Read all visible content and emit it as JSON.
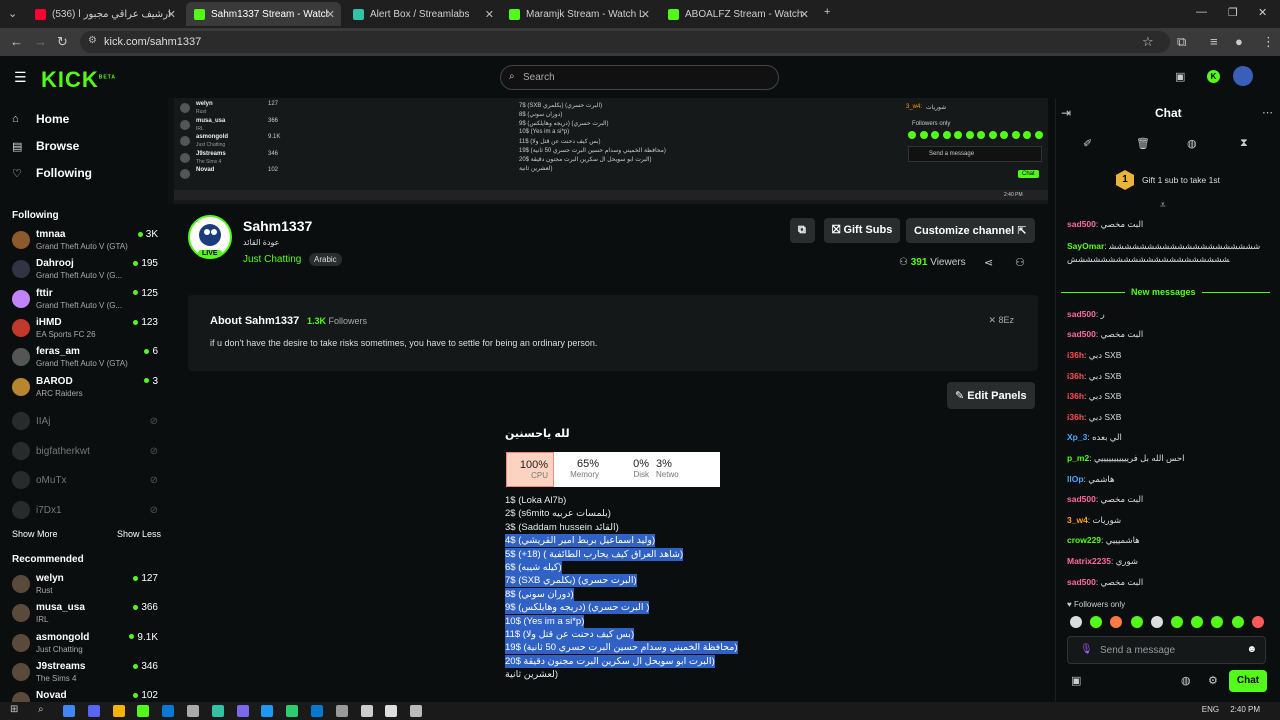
{
  "browser": {
    "tabs": [
      {
        "title": "(536) أرشيف عراقي مجبور أ...",
        "color": "#ff0033",
        "active": false
      },
      {
        "title": "Sahm1337 Stream - Watch Live",
        "color": "#53fc18",
        "active": true
      },
      {
        "title": "Alert Box / Streamlabs",
        "color": "#31c3a2",
        "active": false
      },
      {
        "title": "Maramjk Stream - Watch Live o...",
        "color": "#53fc18",
        "active": false
      },
      {
        "title": "ABOALFZ Stream - Watch Live ...",
        "color": "#53fc18",
        "active": false
      }
    ],
    "new_tab": "+",
    "url": "kick.com/sahm1337"
  },
  "header": {
    "logo": "KICK",
    "logo_sup": "BETA",
    "search_placeholder": "Search"
  },
  "sidebar": {
    "nav": [
      {
        "label": "Home",
        "icon": "home-icon",
        "glyph": "⌂"
      },
      {
        "label": "Browse",
        "icon": "browse-icon",
        "glyph": "▤"
      },
      {
        "label": "Following",
        "icon": "heart-icon",
        "glyph": "♡"
      }
    ],
    "following_title": "Following",
    "following": [
      {
        "name": "tmnaa",
        "game": "Grand Theft Auto V (GTA)",
        "viewers": "3K",
        "live": true
      },
      {
        "name": "Dahrooj",
        "game": "Grand Theft Auto V (G...",
        "viewers": "195",
        "live": true
      },
      {
        "name": "fttir",
        "game": "Grand Theft Auto V (G...",
        "viewers": "125",
        "live": true
      },
      {
        "name": "iHMD",
        "game": "EA Sports FC 26",
        "viewers": "123",
        "live": true
      },
      {
        "name": "feras_am",
        "game": "Grand Theft Auto V (GTA)",
        "viewers": "6",
        "live": true
      },
      {
        "name": "BAROD",
        "game": "ARC Raiders",
        "viewers": "3",
        "live": true
      },
      {
        "name": "IIAj",
        "game": "",
        "viewers": "",
        "live": false
      },
      {
        "name": "bigfatherkwt",
        "game": "",
        "viewers": "",
        "live": false
      },
      {
        "name": "oMuTx",
        "game": "",
        "viewers": "",
        "live": false
      },
      {
        "name": "i7Dx1",
        "game": "",
        "viewers": "",
        "live": false
      }
    ],
    "show_more": "Show More",
    "show_less": "Show Less",
    "recommended_title": "Recommended",
    "recommended": [
      {
        "name": "welyn",
        "game": "Rust",
        "viewers": "127"
      },
      {
        "name": "musa_usa",
        "game": "IRL",
        "viewers": "366"
      },
      {
        "name": "asmongold",
        "game": "Just Chatting",
        "viewers": "9.1K"
      },
      {
        "name": "J9streams",
        "game": "The Sims 4",
        "viewers": "346"
      },
      {
        "name": "Novad",
        "game": "",
        "viewers": "102"
      }
    ]
  },
  "stream_preview": {
    "mini_channels": [
      {
        "name": "welyn",
        "game": "Rust",
        "viewers": "127"
      },
      {
        "name": "musa_usa",
        "game": "IRL",
        "viewers": "366"
      },
      {
        "name": "asmongold",
        "game": "Just Chatting",
        "viewers": "9.1K"
      },
      {
        "name": "J9streams",
        "game": "The Sims 4",
        "viewers": "346"
      },
      {
        "name": "Novad",
        "game": "",
        "viewers": "102"
      }
    ],
    "mini_lines": [
      "7$ (SXB بكلمري) (البرت حسري)",
      "8$ (دوران سوني)",
      "9$ (دريجه وهايلكس) (البرت حسري)",
      "10$ (Yes im a si*p)",
      "11$ (بس كيف دحنت عن قتل ولا)",
      "19$ (محافظة الخميني وسدام حسين البرت حسري 50 ثانية)",
      "20$ البرت ابو سويحل ال سكرين البرت مجنون دقيقة)",
      "لعشرين ثانية)"
    ],
    "mini_chat_user": "3_w4:",
    "mini_chat_text": "شوريات",
    "mini_followers": "Followers only",
    "mini_send": "Send a message",
    "mini_chat_btn": "Chat",
    "mini_time": "2:40 PM"
  },
  "channel": {
    "name": "Sahm1337",
    "subtitle": "عودة القائد",
    "live_badge": "LIVE",
    "category": "Just Chatting",
    "language": "Arabic",
    "gift_subs": "Gift Subs",
    "customize": "Customize channel",
    "viewers_count": "391",
    "viewers_label": "Viewers"
  },
  "about": {
    "title": "About Sahm1337",
    "followers_count": "1.3K",
    "followers_label": "Followers",
    "description": "if u don't have the desire to take risks sometimes, you have to settle for being an ordinary person.",
    "x_handle": "8Ez"
  },
  "edit_panels": "Edit Panels",
  "panel": {
    "title": "لله ياحسنين",
    "task_manager": [
      {
        "pct": "100%",
        "label": "CPU"
      },
      {
        "pct": "65%",
        "label": "Memory"
      },
      {
        "pct": "0%",
        "label": "Disk"
      },
      {
        "pct": "3%",
        "label": "Netwo"
      }
    ],
    "lines": [
      {
        "text": "1$ (Loka Al7b)",
        "selected": false
      },
      {
        "text": "2$ (s6mito بلمسات عربيه)",
        "selected": false
      },
      {
        "text": "3$ (Saddam hussein القائد)",
        "selected": false
      },
      {
        "text": "4$ (وليد اسماعيل بربط امير القريشي)",
        "selected": true
      },
      {
        "text": "5$ (+18) ( شاهد العراق كيف يحارب الطائفية)",
        "selected": true
      },
      {
        "text": "6$ (كيله شيبه)",
        "selected": true
      },
      {
        "text": "7$ (SXB بكلمري) (البرت حسري)",
        "selected": true
      },
      {
        "text": "8$ (دوران سوني)",
        "selected": true
      },
      {
        "text": "9$ (دريجه وهايلكس) (البرت حسري )",
        "selected": true
      },
      {
        "text": "10$ (Yes im a si*p)",
        "selected": true
      },
      {
        "text": "11$ (بس كيف دحنت عن قتل ولا)",
        "selected": true
      },
      {
        "text": "19$ (محافظة الخميني وسدام حسين البرت حسري 50 ثانية)",
        "selected": true
      },
      {
        "text": "20$ البرت ابو سويحل ال سكرين البرت مجنون دقيقة)",
        "selected": true
      },
      {
        "text": "لعشرين ثانية)",
        "selected": false
      }
    ]
  },
  "chat": {
    "title": "Chat",
    "gift_rank": "1",
    "gift_text": "Gift 1 sub to take 1st",
    "new_messages": "New messages",
    "messages": [
      {
        "user": "sad500",
        "color": "#ff6b9d",
        "text": "البت مخصي"
      },
      {
        "user": "SayOmar",
        "color": "#53fc18",
        "text": "‏ششششششششششششششششششششششششششششششششششششششششش"
      },
      {
        "user": "sad500",
        "color": "#ff6b9d",
        "text": "ر"
      },
      {
        "user": "sad500",
        "color": "#ff6b9d",
        "text": "البت مخصي"
      },
      {
        "user": "i36h",
        "color": "#ff4d4d",
        "text": "دبي SXB"
      },
      {
        "user": "i36h",
        "color": "#ff4d4d",
        "text": "دبي SXB"
      },
      {
        "user": "i36h",
        "color": "#ff4d4d",
        "text": "دبي SXB"
      },
      {
        "user": "i36h",
        "color": "#ff4d4d",
        "text": "دبي SXB"
      },
      {
        "user": "Xp_3",
        "color": "#4da6ff",
        "text": "الي بعده"
      },
      {
        "user": "p_m2",
        "color": "#53fc18",
        "text": "احس الله بل فريييييييييييي"
      },
      {
        "user": "llOp",
        "color": "#4da6ff",
        "text": "هاشمي"
      },
      {
        "user": "sad500",
        "color": "#ff6b9d",
        "text": "البت مخصي"
      },
      {
        "user": "3_w4",
        "color": "#ff9f1a",
        "text": "شوريات"
      },
      {
        "user": "crow229",
        "color": "#53fc18",
        "text": "هاشميييي"
      },
      {
        "user": "Matrix2235",
        "color": "#ff6b9d",
        "text": "شوري"
      },
      {
        "user": "sad500",
        "color": "#ff6b9d",
        "text": "البت مخصي"
      }
    ],
    "followers_only": "Followers only",
    "send_placeholder": "Send a message",
    "chat_button": "Chat"
  },
  "taskbar": {
    "lang": "ENG",
    "time": "2:40 PM"
  }
}
